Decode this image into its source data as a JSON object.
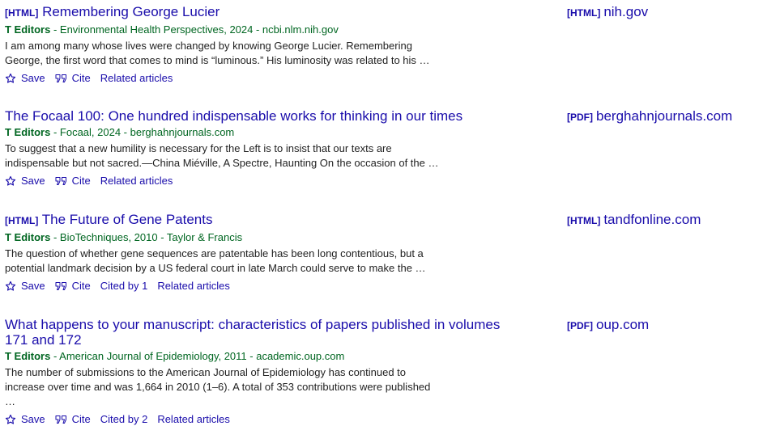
{
  "results": [
    {
      "tag": "[HTML]",
      "title": "Remembering George Lucier",
      "author": "T Editors",
      "venue": " - Environmental Health Perspectives, 2024 - ncbi.nlm.nih.gov",
      "snippet": "I am among many whose lives were changed by knowing George Lucier. Remembering George, the first word that comes to mind is “luminous.” His luminosity was related to his …",
      "actions": {
        "save": "Save",
        "cite": "Cite",
        "cited_by": "",
        "related": "Related articles"
      },
      "side_tag": "[HTML]",
      "side_source": "nih.gov"
    },
    {
      "tag": "",
      "title": "The Focaal 100: One hundred indispensable works for thinking in our times",
      "author": "T Editors",
      "venue": " - Focaal, 2024 - berghahnjournals.com",
      "snippet": "To suggest that a new humility is necessary for the Left is to insist that our texts are indispensable but not sacred.—China Miéville, A Spectre, Haunting On the occasion of the …",
      "actions": {
        "save": "Save",
        "cite": "Cite",
        "cited_by": "",
        "related": "Related articles"
      },
      "side_tag": "[PDF]",
      "side_source": "berghahnjournals.com"
    },
    {
      "tag": "[HTML]",
      "title": "The Future of Gene Patents",
      "author": "T Editors",
      "venue": " - BioTechniques, 2010 - Taylor & Francis",
      "snippet": "The question of whether gene sequences are patentable has been long contentious, but a potential landmark decision by a US federal court in late March could serve to make the …",
      "actions": {
        "save": "Save",
        "cite": "Cite",
        "cited_by": "Cited by 1",
        "related": "Related articles"
      },
      "side_tag": "[HTML]",
      "side_source": "tandfonline.com"
    },
    {
      "tag": "",
      "title": "What happens to your manuscript: characteristics of papers published in volumes 171 and 172",
      "author": "T Editors",
      "venue": " - American Journal of Epidemiology, 2011 - academic.oup.com",
      "snippet": "The number of submissions to the American Journal of Epidemiology has continued to increase over time and was 1,664 in 2010 (1–6). A total of 353 contributions were published …",
      "actions": {
        "save": "Save",
        "cite": "Cite",
        "cited_by": "Cited by 2",
        "related": "Related articles"
      },
      "side_tag": "[PDF]",
      "side_source": "oup.com"
    }
  ],
  "icons": {
    "save": "star-outline-icon",
    "cite": "quote-icon"
  },
  "colors": {
    "link": "#1a0dab",
    "meta": "#006621",
    "text": "#222222"
  }
}
